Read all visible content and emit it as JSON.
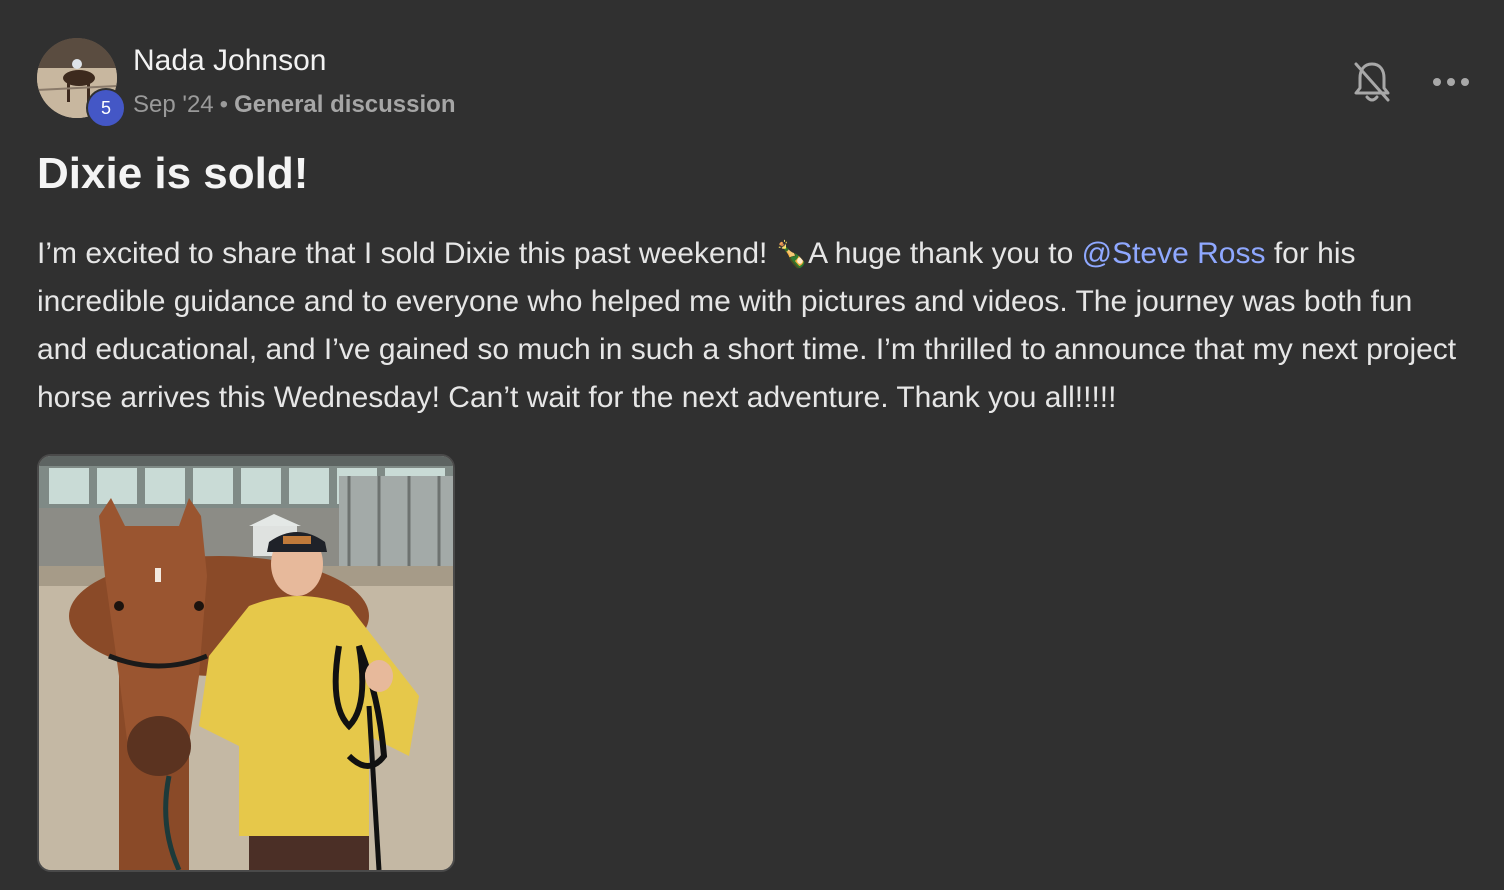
{
  "post": {
    "author": "Nada Johnson",
    "level": "5",
    "date": "Sep '24",
    "separator": "•",
    "category": "General discussion",
    "title": "Dixie is sold!",
    "body_before_mention": "I’m excited to share that I sold Dixie this past weekend! ",
    "emoji": "🍾",
    "body_after_emoji": "A huge thank you to ",
    "mention": "@Steve Ross",
    "body_after_mention": " for his incredible guidance and to everyone who helped me with pictures and videos. The journey was both fun and educational, and I’ve gained so much in such a short time. I’m thrilled to announce that my next project horse arrives this Wednesday! Can’t wait for the next adventure. Thank you all!!!!!"
  },
  "icons": {
    "notification": "bell-off-icon",
    "more": "more-horizontal-icon"
  },
  "colors": {
    "background": "#303030",
    "mention": "#8fa8ff",
    "badge": "#4457c6"
  }
}
